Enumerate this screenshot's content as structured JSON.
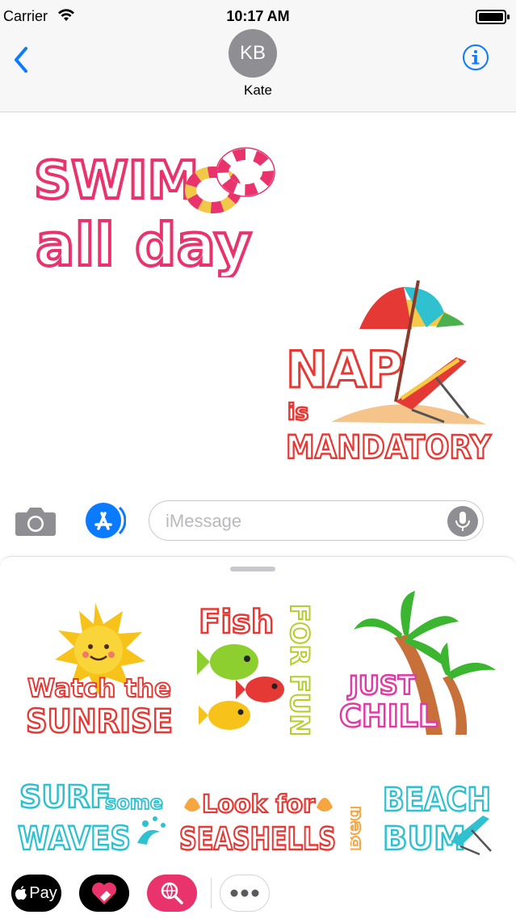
{
  "status": {
    "carrier": "Carrier",
    "time": "10:17 AM"
  },
  "nav": {
    "avatar_initials": "KB",
    "contact_name": "Kate"
  },
  "thread_stickers": [
    {
      "line1": "SWIM",
      "line2": "all day"
    },
    {
      "line1": "NAP",
      "line2": "is",
      "line3": "MANDATORY"
    }
  ],
  "input": {
    "placeholder": "iMessage"
  },
  "drawer_stickers": [
    {
      "line1": "Watch the",
      "line2": "SUNRISE"
    },
    {
      "line1": "Fish",
      "line2": "FOR FUN"
    },
    {
      "line1": "JUST",
      "line2": "CHILL"
    },
    {
      "line1": "SURF",
      "line1b": "some",
      "line2": "WAVES"
    },
    {
      "line1": "Look for",
      "line2": "SEASHELLS"
    },
    {
      "line1": "BEACH",
      "line2": "BUM",
      "side": "Bed"
    }
  ],
  "dock": {
    "applepay_label": "Pay"
  },
  "colors": {
    "ios_blue": "#0a7aff",
    "sticker_pink": "#e8336d",
    "sticker_red": "#e53935",
    "teal": "#2fc1cf"
  }
}
